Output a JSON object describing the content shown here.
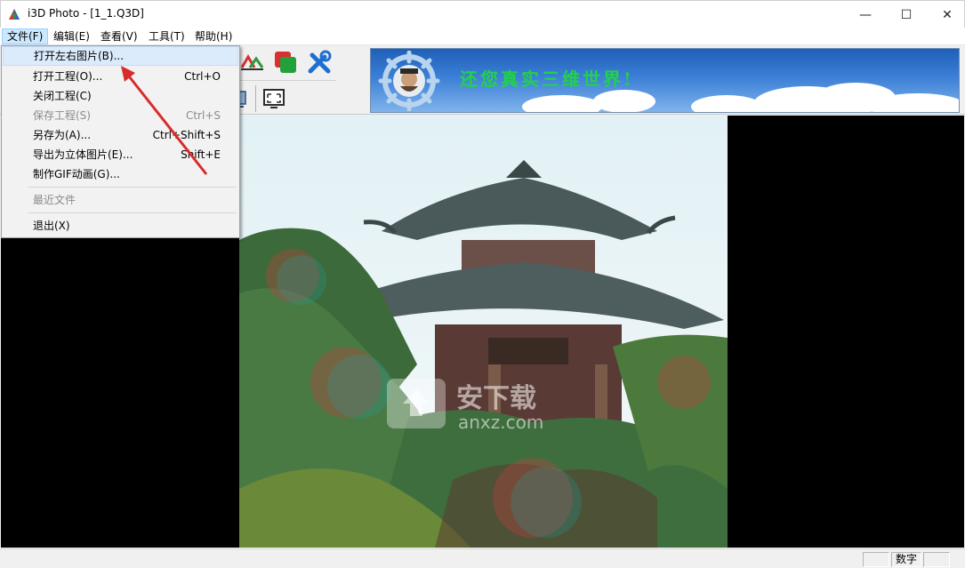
{
  "window": {
    "title": "i3D Photo - [1_1.Q3D]",
    "minimize_glyph": "—",
    "maximize_glyph": "☐",
    "close_glyph": "✕"
  },
  "menubar": {
    "items": [
      {
        "label": "文件(F)"
      },
      {
        "label": "编辑(E)"
      },
      {
        "label": "查看(V)"
      },
      {
        "label": "工具(T)"
      },
      {
        "label": "帮助(H)"
      }
    ]
  },
  "file_menu": {
    "items": [
      {
        "label": "打开左右图片(B)...",
        "shortcut": ""
      },
      {
        "label": "打开工程(O)...",
        "shortcut": "Ctrl+O"
      },
      {
        "label": "关闭工程(C)",
        "shortcut": ""
      },
      {
        "label": "保存工程(S)",
        "shortcut": "Ctrl+S"
      },
      {
        "label": "另存为(A)...",
        "shortcut": "Ctrl+Shift+S"
      },
      {
        "label": "导出为立体图片(E)...",
        "shortcut": "Shift+E"
      },
      {
        "label": "制作GIF动画(G)...",
        "shortcut": ""
      },
      {
        "label": "最近文件",
        "shortcut": ""
      },
      {
        "label": "退出(X)",
        "shortcut": ""
      }
    ]
  },
  "banner": {
    "slogan": "还您真实三维世界!"
  },
  "statusbar": {
    "num_indicator": "数字"
  },
  "watermark": {
    "text": "安下载",
    "domain": "anxz.com"
  },
  "colors": {
    "menu_active": "#cce8ff",
    "banner_blue": "#2a6cc8",
    "slogan_green": "#22d14a",
    "annotation_arrow": "#d82c2c"
  },
  "icons": [
    "app-icon",
    "transform-icon",
    "color-block-icon",
    "tools-icon",
    "monitor-icon",
    "fullscreen-icon",
    "helm-logo-icon"
  ]
}
